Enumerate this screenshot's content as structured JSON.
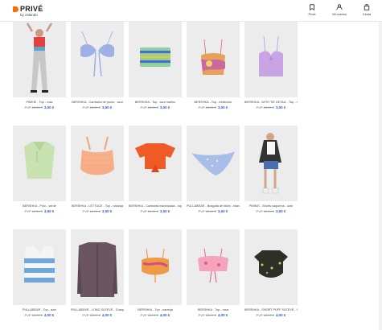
{
  "brand": {
    "name": "PRIVÉ",
    "sub": "by zalando"
  },
  "header_actions": [
    {
      "label": "Privé",
      "icon": "bookmark-icon"
    },
    {
      "label": "Mi cuenta",
      "icon": "user-icon"
    },
    {
      "label": "Cesta",
      "icon": "bag-icon"
    }
  ],
  "products": [
    {
      "name": "PIMKIE - Top - rosa",
      "pvp": "PVP",
      "old": "12,99 €",
      "price": "3,50 €",
      "art": "model"
    },
    {
      "name": "BERSHKA - Camiseta de punto - azul",
      "pvp": "PVP",
      "old": "12,99 €",
      "price": "3,50 €",
      "art": "bikini-blue"
    },
    {
      "name": "BERSHKA - Top - azul marino",
      "pvp": "PVP",
      "old": "12,99 €",
      "price": "3,50 €",
      "art": "bandeau"
    },
    {
      "name": "BERSHKA - Top - multicolor",
      "pvp": "PVP",
      "old": "12,99 €",
      "price": "3,50 €",
      "art": "tie-dye"
    },
    {
      "name": "BERSHKA - WITH TIE DETAIL - Top - morado pigmento",
      "pvp": "PVP",
      "old": "12,99 €",
      "price": "3,50 €",
      "art": "lilac"
    },
    {
      "name": "BERSHKA - Polo - verde",
      "pvp": "PVP",
      "old": "12,99 €",
      "price": "3,50 €",
      "art": "green-polo"
    },
    {
      "name": "BERSHKA - LETTUCE - Top - naranja",
      "pvp": "PVP",
      "old": "12,99 €",
      "price": "3,50 €",
      "art": "peach"
    },
    {
      "name": "BERSHKA - Camiseta estampada - rojo",
      "pvp": "PVP",
      "old": "12,99 €",
      "price": "3,50 €",
      "art": "red-tie"
    },
    {
      "name": "PULL&BEAR - Braguita de bikini - blanco",
      "pvp": "PVP",
      "old": "12,99 €",
      "price": "3,50 €",
      "art": "bikini-bottom"
    },
    {
      "name": "PIMKIE - Shorts vaqueros - azul",
      "pvp": "PVP",
      "old": "12,99 €",
      "price": "3,50 €",
      "art": "model2"
    },
    {
      "name": "PULL&BEAR - Top - azul",
      "pvp": "PVP",
      "old": "12,99 €",
      "price": "4,00 €",
      "art": "stripe-vest"
    },
    {
      "name": "PULL&BEAR - LONG SLEEVE - Chaqueta de punto - rosa",
      "pvp": "PVP",
      "old": "12,99 €",
      "price": "4,00 €",
      "art": "cardigan"
    },
    {
      "name": "BERSHKA - Top - naranja",
      "pvp": "PVP",
      "old": "12,99 €",
      "price": "4,00 €",
      "art": "multi-top"
    },
    {
      "name": "BERSHKA - Top - rosa",
      "pvp": "PVP",
      "old": "12,99 €",
      "price": "4,00 €",
      "art": "pink-top"
    },
    {
      "name": "BERSHKA - SHORT PUFF SLEEVE - Camiseta estampada - negro",
      "pvp": "PVP",
      "old": "12,99 €",
      "price": "4,00 €",
      "art": "floral"
    }
  ],
  "colors": {
    "accent": "#ff6900",
    "price": "#3a5bd9"
  }
}
